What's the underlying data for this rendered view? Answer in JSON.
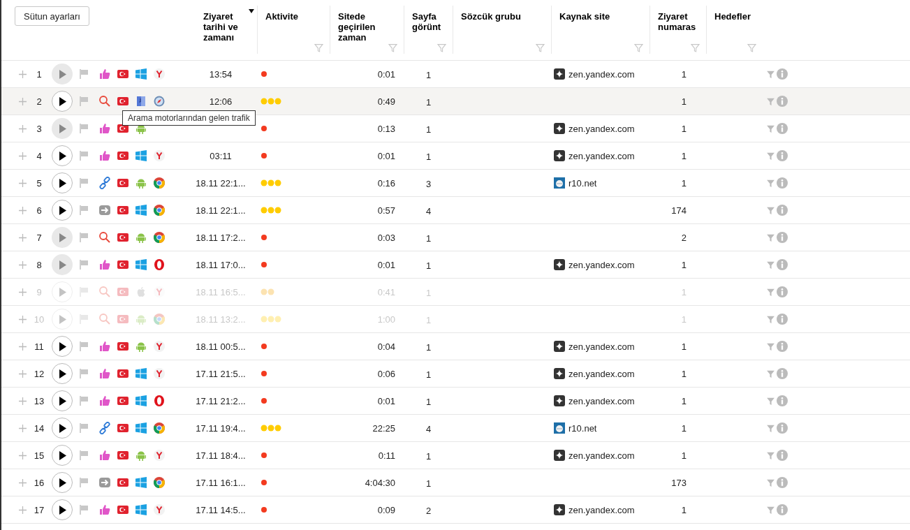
{
  "toolbar": {
    "column_settings_button": "Sütun ayarları"
  },
  "columns": [
    {
      "label": "Ziyaret tarihi ve zamanı",
      "sorted": true,
      "filter": false
    },
    {
      "label": "Aktivite",
      "sorted": false,
      "filter": true
    },
    {
      "label": "Sitede geçirilen zaman",
      "sorted": false,
      "filter": true
    },
    {
      "label": "Sayfa görünt",
      "sorted": false,
      "filter": true
    },
    {
      "label": "Sözcük grubu",
      "sorted": false,
      "filter": true
    },
    {
      "label": "Kaynak site",
      "sorted": false,
      "filter": true
    },
    {
      "label": "Ziyaret numaras",
      "sorted": false,
      "filter": true
    },
    {
      "label": "Hedefler",
      "sorted": false,
      "filter": true
    }
  ],
  "rows": [
    {
      "number": "1",
      "viewed": true,
      "faded": false,
      "highlighted": false,
      "source": {
        "kind": "thumbs"
      },
      "country": {
        "kind": "tr"
      },
      "os": {
        "kind": "windows"
      },
      "browser": {
        "kind": "yandex"
      },
      "time": "13:54",
      "activity": {
        "kind": "low"
      },
      "duration": "0:01",
      "pageviews": "1",
      "referrer": {
        "kind": "zen",
        "text": "zen.yandex.com"
      },
      "visit_number": "1"
    },
    {
      "number": "2",
      "viewed": false,
      "faded": false,
      "highlighted": true,
      "source": {
        "kind": "search"
      },
      "country": {
        "kind": "tr"
      },
      "os": {
        "kind": "mac"
      },
      "browser": {
        "kind": "safari"
      },
      "time": "12:06",
      "activity": {
        "kind": "high"
      },
      "duration": "0:49",
      "pageviews": "1",
      "visit_number": "1"
    },
    {
      "number": "3",
      "viewed": true,
      "faded": false,
      "highlighted": false,
      "source": {
        "kind": "thumbs"
      },
      "country": {
        "kind": "tr"
      },
      "os": {
        "kind": "android"
      },
      "activity": {
        "kind": "low"
      },
      "duration": "0:13",
      "pageviews": "1",
      "referrer": {
        "kind": "zen",
        "text": "zen.yandex.com"
      },
      "visit_number": "1"
    },
    {
      "number": "4",
      "viewed": false,
      "faded": false,
      "highlighted": false,
      "source": {
        "kind": "thumbs"
      },
      "country": {
        "kind": "tr"
      },
      "os": {
        "kind": "windows"
      },
      "browser": {
        "kind": "yandex"
      },
      "time": "03:11",
      "activity": {
        "kind": "low"
      },
      "duration": "0:01",
      "pageviews": "1",
      "referrer": {
        "kind": "zen",
        "text": "zen.yandex.com"
      },
      "visit_number": "1"
    },
    {
      "number": "5",
      "viewed": false,
      "faded": false,
      "highlighted": false,
      "source": {
        "kind": "link"
      },
      "country": {
        "kind": "tr"
      },
      "os": {
        "kind": "android"
      },
      "browser": {
        "kind": "chrome"
      },
      "time": "18.11 22:1...",
      "activity": {
        "kind": "high"
      },
      "duration": "0:16",
      "pageviews": "3",
      "referrer": {
        "kind": "r10",
        "text": "r10.net"
      },
      "visit_number": "1"
    },
    {
      "number": "6",
      "viewed": false,
      "faded": false,
      "highlighted": false,
      "source": {
        "kind": "direct"
      },
      "country": {
        "kind": "tr"
      },
      "os": {
        "kind": "windows"
      },
      "browser": {
        "kind": "chrome"
      },
      "time": "18.11 22:1...",
      "activity": {
        "kind": "high"
      },
      "duration": "0:57",
      "pageviews": "4",
      "visit_number": "174"
    },
    {
      "number": "7",
      "viewed": true,
      "faded": false,
      "highlighted": false,
      "source": {
        "kind": "search"
      },
      "country": {
        "kind": "tr"
      },
      "os": {
        "kind": "android"
      },
      "browser": {
        "kind": "chrome"
      },
      "time": "18.11 17:2...",
      "activity": {
        "kind": "low"
      },
      "duration": "0:03",
      "pageviews": "1",
      "visit_number": "2"
    },
    {
      "number": "8",
      "viewed": true,
      "faded": false,
      "highlighted": false,
      "source": {
        "kind": "thumbs"
      },
      "country": {
        "kind": "tr"
      },
      "os": {
        "kind": "windows"
      },
      "browser": {
        "kind": "opera"
      },
      "time": "18.11 17:0...",
      "activity": {
        "kind": "low"
      },
      "duration": "0:01",
      "pageviews": "1",
      "referrer": {
        "kind": "zen",
        "text": "zen.yandex.com"
      },
      "visit_number": "1"
    },
    {
      "number": "9",
      "viewed": false,
      "faded": true,
      "highlighted": false,
      "source": {
        "kind": "search"
      },
      "country": {
        "kind": "tr"
      },
      "os": {
        "kind": "apple"
      },
      "browser": {
        "kind": "yandex"
      },
      "time": "18.11 16:5...",
      "activity": {
        "kind": "medium"
      },
      "duration": "0:41",
      "pageviews": "1",
      "visit_number": "1"
    },
    {
      "number": "10",
      "viewed": false,
      "faded": true,
      "highlighted": false,
      "source": {
        "kind": "search"
      },
      "country": {
        "kind": "tr"
      },
      "os": {
        "kind": "android"
      },
      "browser": {
        "kind": "chrome"
      },
      "time": "18.11 13:2...",
      "activity": {
        "kind": "high"
      },
      "duration": "1:00",
      "pageviews": "1",
      "visit_number": "1"
    },
    {
      "number": "11",
      "viewed": false,
      "faded": false,
      "highlighted": false,
      "source": {
        "kind": "thumbs"
      },
      "country": {
        "kind": "tr"
      },
      "os": {
        "kind": "android"
      },
      "browser": {
        "kind": "yandex"
      },
      "time": "18.11 00:5...",
      "activity": {
        "kind": "low"
      },
      "duration": "0:04",
      "pageviews": "1",
      "referrer": {
        "kind": "zen",
        "text": "zen.yandex.com"
      },
      "visit_number": "1"
    },
    {
      "number": "12",
      "viewed": false,
      "faded": false,
      "highlighted": false,
      "source": {
        "kind": "thumbs"
      },
      "country": {
        "kind": "tr"
      },
      "os": {
        "kind": "windows"
      },
      "browser": {
        "kind": "yandex"
      },
      "time": "17.11 21:5...",
      "activity": {
        "kind": "low"
      },
      "duration": "0:06",
      "pageviews": "1",
      "referrer": {
        "kind": "zen",
        "text": "zen.yandex.com"
      },
      "visit_number": "1"
    },
    {
      "number": "13",
      "viewed": false,
      "faded": false,
      "highlighted": false,
      "source": {
        "kind": "thumbs"
      },
      "country": {
        "kind": "tr"
      },
      "os": {
        "kind": "windows"
      },
      "browser": {
        "kind": "opera"
      },
      "time": "17.11 21:2...",
      "activity": {
        "kind": "low"
      },
      "duration": "0:01",
      "pageviews": "1",
      "referrer": {
        "kind": "zen",
        "text": "zen.yandex.com"
      },
      "visit_number": "1"
    },
    {
      "number": "14",
      "viewed": false,
      "faded": false,
      "highlighted": false,
      "source": {
        "kind": "link"
      },
      "country": {
        "kind": "tr"
      },
      "os": {
        "kind": "windows"
      },
      "browser": {
        "kind": "chrome"
      },
      "time": "17.11 19:4...",
      "activity": {
        "kind": "high"
      },
      "duration": "22:25",
      "pageviews": "4",
      "referrer": {
        "kind": "r10",
        "text": "r10.net"
      },
      "visit_number": "1"
    },
    {
      "number": "15",
      "viewed": false,
      "faded": false,
      "highlighted": false,
      "source": {
        "kind": "thumbs"
      },
      "country": {
        "kind": "tr"
      },
      "os": {
        "kind": "android"
      },
      "browser": {
        "kind": "yandex"
      },
      "time": "17.11 18:4...",
      "activity": {
        "kind": "low"
      },
      "duration": "0:11",
      "pageviews": "1",
      "referrer": {
        "kind": "zen",
        "text": "zen.yandex.com"
      },
      "visit_number": "1"
    },
    {
      "number": "16",
      "viewed": false,
      "faded": false,
      "highlighted": false,
      "source": {
        "kind": "direct"
      },
      "country": {
        "kind": "tr"
      },
      "os": {
        "kind": "windows"
      },
      "browser": {
        "kind": "chrome"
      },
      "time": "17.11 16:1...",
      "activity": {
        "kind": "low"
      },
      "duration": "4:04:30",
      "pageviews": "1",
      "visit_number": "173"
    },
    {
      "number": "17",
      "viewed": false,
      "faded": false,
      "highlighted": false,
      "source": {
        "kind": "thumbs"
      },
      "country": {
        "kind": "tr"
      },
      "os": {
        "kind": "windows"
      },
      "browser": {
        "kind": "yandex"
      },
      "time": "17.11 14:5...",
      "activity": {
        "kind": "low"
      },
      "duration": "0:09",
      "pageviews": "2",
      "referrer": {
        "kind": "zen",
        "text": "zen.yandex.com"
      },
      "visit_number": "1"
    }
  ],
  "tooltip": {
    "text": "Arama motorlarından gelen trafik"
  }
}
